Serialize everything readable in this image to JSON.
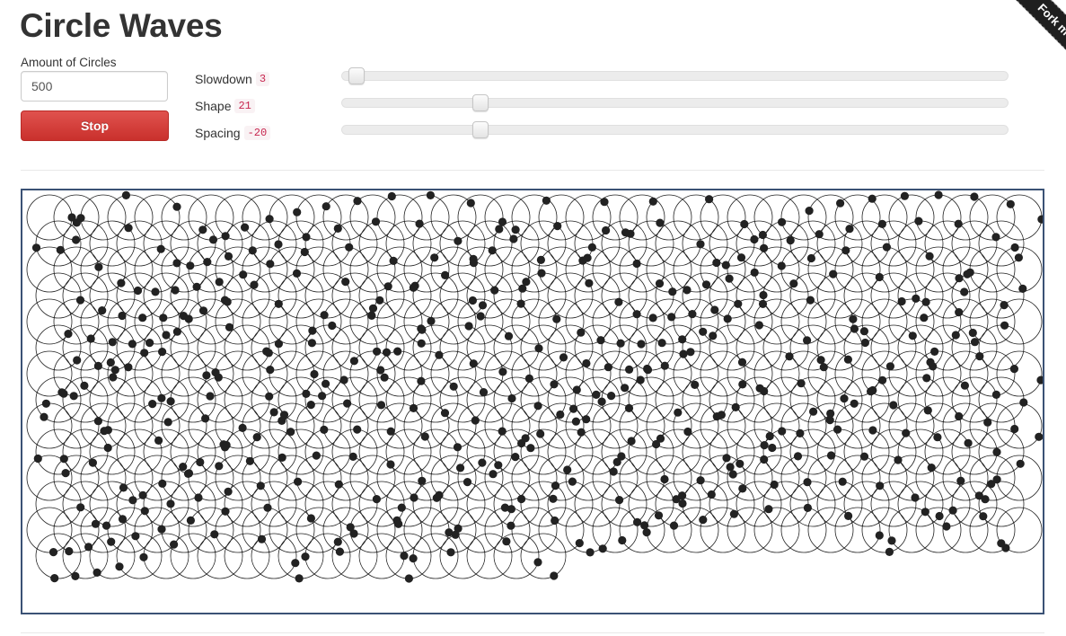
{
  "page": {
    "title": "Circle Waves"
  },
  "controls": {
    "amount_label": "Amount of Circles",
    "amount_value": "500",
    "stop_label": "Stop",
    "params": [
      {
        "name": "Slowdown",
        "value": "3",
        "fraction": 0.01
      },
      {
        "name": "Shape",
        "value": "21",
        "fraction": 0.2
      },
      {
        "name": "Spacing",
        "value": "-20",
        "fraction": 0.2
      }
    ]
  },
  "ribbon": {
    "text": "Fork me on GitHub"
  },
  "colors": {
    "canvas_border": "#3b5275",
    "circle_stroke": "#222222",
    "dot_fill": "#222222",
    "stop_button": "#d9534f"
  },
  "animation": {
    "circle_count": 500
  }
}
